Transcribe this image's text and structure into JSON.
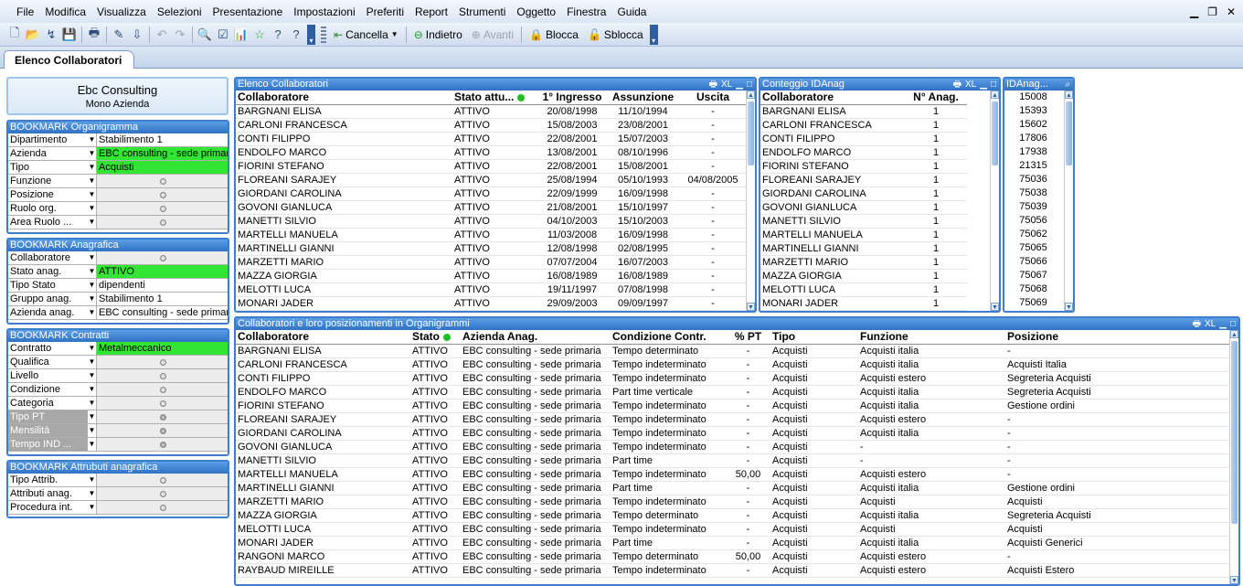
{
  "menu": {
    "items": [
      "File",
      "Modifica",
      "Visualizza",
      "Selezioni",
      "Presentazione",
      "Impostazioni",
      "Preferiti",
      "Report",
      "Strumenti",
      "Oggetto",
      "Finestra",
      "Guida"
    ]
  },
  "toolbar": {
    "cancella": "Cancella",
    "indietro": "Indietro",
    "avanti": "Avanti",
    "blocca": "Blocca",
    "sblocca": "Sblocca"
  },
  "tab": {
    "label": "Elenco Collaboratori"
  },
  "logo": {
    "title": "Ebc Consulting",
    "subtitle": "Mono Azienda"
  },
  "bm_org": {
    "title": "BOOKMARK Organigramma",
    "rows": [
      {
        "label": "Dipartimento",
        "value": "Stabilimento 1",
        "state": "val"
      },
      {
        "label": "Azienda",
        "value": "EBC consulting - sede primaria",
        "state": "sel"
      },
      {
        "label": "Tipo",
        "value": "Acquisti",
        "state": "sel"
      },
      {
        "label": "Funzione",
        "value": "",
        "state": "empty"
      },
      {
        "label": "Posizione",
        "value": "",
        "state": "empty"
      },
      {
        "label": "Ruolo org.",
        "value": "",
        "state": "empty"
      },
      {
        "label": "Area Ruolo ...",
        "value": "",
        "state": "empty"
      }
    ]
  },
  "bm_anag": {
    "title": "BOOKMARK Anagrafica",
    "rows": [
      {
        "label": "Collaboratore",
        "value": "",
        "state": "empty"
      },
      {
        "label": "Stato anag.",
        "value": "ATTIVO",
        "state": "sel"
      },
      {
        "label": "Tipo Stato",
        "value": "dipendenti",
        "state": "val"
      },
      {
        "label": "Gruppo anag.",
        "value": "Stabilimento 1",
        "state": "val"
      },
      {
        "label": "Azienda anag.",
        "value": "EBC consulting - sede primaria",
        "state": "val"
      }
    ]
  },
  "bm_contr": {
    "title": "BOOKMARK Contratti",
    "rows": [
      {
        "label": "Contratto",
        "value": "Metalmeccanico",
        "state": "sel"
      },
      {
        "label": "Qualifica",
        "value": "",
        "state": "empty"
      },
      {
        "label": "Livello",
        "value": "",
        "state": "empty"
      },
      {
        "label": "Condizione",
        "value": "",
        "state": "empty"
      },
      {
        "label": "Categoria",
        "value": "",
        "state": "empty"
      },
      {
        "label": "Tipo PT",
        "value": "",
        "state": "grey"
      },
      {
        "label": "Mensilità",
        "value": "",
        "state": "grey"
      },
      {
        "label": "Tempo IND ...",
        "value": "",
        "state": "grey"
      }
    ]
  },
  "bm_attr": {
    "title": "BOOKMARK Attrubuti anagrafica",
    "rows": [
      {
        "label": "Tipo Attrib.",
        "value": "",
        "state": "empty"
      },
      {
        "label": "Attributi anag.",
        "value": "",
        "state": "empty"
      },
      {
        "label": "Procedura int.",
        "value": "",
        "state": "empty"
      }
    ]
  },
  "elenco": {
    "title": "Elenco Collaboratori",
    "cols": [
      "Collaboratore",
      "Stato attu...",
      "1° Ingresso",
      "Assunzione",
      "Uscita"
    ],
    "rows": [
      [
        "BARGNANI ELISA",
        "ATTIVO",
        "20/08/1998",
        "11/10/1994",
        "-"
      ],
      [
        "CARLONI FRANCESCA",
        "ATTIVO",
        "15/08/2003",
        "23/08/2001",
        "-"
      ],
      [
        "CONTI FILIPPO",
        "ATTIVO",
        "22/08/2001",
        "15/07/2003",
        "-"
      ],
      [
        "ENDOLFO MARCO",
        "ATTIVO",
        "13/08/2001",
        "08/10/1996",
        "-"
      ],
      [
        "FIORINI STEFANO",
        "ATTIVO",
        "22/08/2001",
        "15/08/2001",
        "-"
      ],
      [
        "FLOREANI SARAJEY",
        "ATTIVO",
        "25/08/1994",
        "05/10/1993",
        "04/08/2005"
      ],
      [
        "GIORDANI CAROLINA",
        "ATTIVO",
        "22/09/1999",
        "16/09/1998",
        "-"
      ],
      [
        "GOVONI GIANLUCA",
        "ATTIVO",
        "21/08/2001",
        "15/10/1997",
        "-"
      ],
      [
        "MANETTI SILVIO",
        "ATTIVO",
        "04/10/2003",
        "15/10/2003",
        "-"
      ],
      [
        "MARTELLI MANUELA",
        "ATTIVO",
        "11/03/2008",
        "16/09/1998",
        "-"
      ],
      [
        "MARTINELLI GIANNI",
        "ATTIVO",
        "12/08/1998",
        "02/08/1995",
        "-"
      ],
      [
        "MARZETTI MARIO",
        "ATTIVO",
        "07/07/2004",
        "16/07/2003",
        "-"
      ],
      [
        "MAZZA GIORGIA",
        "ATTIVO",
        "16/08/1989",
        "16/08/1989",
        "-"
      ],
      [
        "MELOTTI LUCA",
        "ATTIVO",
        "19/11/1997",
        "07/08/1998",
        "-"
      ],
      [
        "MONARI JADER",
        "ATTIVO",
        "29/09/2003",
        "09/09/1997",
        "-"
      ]
    ]
  },
  "conteggio": {
    "title": "Conteggio IDAnag",
    "cols": [
      "Collaboratore",
      "N° Anag."
    ],
    "rows": [
      [
        "BARGNANI ELISA",
        "1"
      ],
      [
        "CARLONI FRANCESCA",
        "1"
      ],
      [
        "CONTI FILIPPO",
        "1"
      ],
      [
        "ENDOLFO MARCO",
        "1"
      ],
      [
        "FIORINI STEFANO",
        "1"
      ],
      [
        "FLOREANI SARAJEY",
        "1"
      ],
      [
        "GIORDANI CAROLINA",
        "1"
      ],
      [
        "GOVONI GIANLUCA",
        "1"
      ],
      [
        "MANETTI SILVIO",
        "1"
      ],
      [
        "MARTELLI MANUELA",
        "1"
      ],
      [
        "MARTINELLI GIANNI",
        "1"
      ],
      [
        "MARZETTI MARIO",
        "1"
      ],
      [
        "MAZZA GIORGIA",
        "1"
      ],
      [
        "MELOTTI LUCA",
        "1"
      ],
      [
        "MONARI JADER",
        "1"
      ]
    ]
  },
  "idanag": {
    "title": "IDAnag...",
    "rows": [
      "15008",
      "15393",
      "15602",
      "17806",
      "17938",
      "21315",
      "75036",
      "75038",
      "75039",
      "75056",
      "75062",
      "75065",
      "75066",
      "75067",
      "75068",
      "75069"
    ]
  },
  "pos": {
    "title": "Collaboratori e loro posizionamenti in Organigrammi",
    "cols": [
      "Collaboratore",
      "Stato",
      "Azienda Anag.",
      "Condizione Contr.",
      "% PT",
      "Tipo",
      "Funzione",
      "Posizione"
    ],
    "rows": [
      [
        "BARGNANI ELISA",
        "ATTIVO",
        "EBC consulting - sede primaria",
        "Tempo determinato",
        "-",
        "Acquisti",
        "Acquisti italia",
        "-"
      ],
      [
        "CARLONI FRANCESCA",
        "ATTIVO",
        "EBC consulting - sede primaria",
        "Tempo indeterminato",
        "-",
        "Acquisti",
        "Acquisti italia",
        "Acquisti Italia"
      ],
      [
        "CONTI FILIPPO",
        "ATTIVO",
        "EBC consulting - sede primaria",
        "Tempo indeterminato",
        "-",
        "Acquisti",
        "Acquisti estero",
        "Segreteria Acquisti"
      ],
      [
        "ENDOLFO MARCO",
        "ATTIVO",
        "EBC consulting - sede primaria",
        "Part time verticale",
        "-",
        "Acquisti",
        "Acquisti italia",
        "Segreteria Acquisti"
      ],
      [
        "FIORINI STEFANO",
        "ATTIVO",
        "EBC consulting - sede primaria",
        "Tempo indeterminato",
        "-",
        "Acquisti",
        "Acquisti italia",
        "Gestione ordini"
      ],
      [
        "FLOREANI SARAJEY",
        "ATTIVO",
        "EBC consulting - sede primaria",
        "Tempo indeterminato",
        "-",
        "Acquisti",
        "Acquisti estero",
        "-"
      ],
      [
        "GIORDANI CAROLINA",
        "ATTIVO",
        "EBC consulting - sede primaria",
        "Tempo indeterminato",
        "-",
        "Acquisti",
        "Acquisti italia",
        "-"
      ],
      [
        "GOVONI GIANLUCA",
        "ATTIVO",
        "EBC consulting - sede primaria",
        "Tempo indeterminato",
        "-",
        "Acquisti",
        "-",
        "-"
      ],
      [
        "MANETTI SILVIO",
        "ATTIVO",
        "EBC consulting - sede primaria",
        "Part time",
        "-",
        "Acquisti",
        "-",
        "-"
      ],
      [
        "MARTELLI MANUELA",
        "ATTIVO",
        "EBC consulting - sede primaria",
        "Tempo indeterminato",
        "50,00",
        "Acquisti",
        "Acquisti estero",
        "-"
      ],
      [
        "MARTINELLI GIANNI",
        "ATTIVO",
        "EBC consulting - sede primaria",
        "Part time",
        "-",
        "Acquisti",
        "Acquisti italia",
        "Gestione ordini"
      ],
      [
        "MARZETTI MARIO",
        "ATTIVO",
        "EBC consulting - sede primaria",
        "Tempo indeterminato",
        "-",
        "Acquisti",
        "Acquisti",
        "Acquisti"
      ],
      [
        "MAZZA GIORGIA",
        "ATTIVO",
        "EBC consulting - sede primaria",
        "Tempo determinato",
        "-",
        "Acquisti",
        "Acquisti italia",
        "Segreteria Acquisti"
      ],
      [
        "MELOTTI LUCA",
        "ATTIVO",
        "EBC consulting - sede primaria",
        "Tempo indeterminato",
        "-",
        "Acquisti",
        "Acquisti",
        "Acquisti"
      ],
      [
        "MONARI JADER",
        "ATTIVO",
        "EBC consulting - sede primaria",
        "Part time",
        "-",
        "Acquisti",
        "Acquisti italia",
        "Acquisti Generici"
      ],
      [
        "RANGONI MARCO",
        "ATTIVO",
        "EBC consulting - sede primaria",
        "Tempo determinato",
        "50,00",
        "Acquisti",
        "Acquisti estero",
        "-"
      ],
      [
        "RAYBAUD MIREILLE",
        "ATTIVO",
        "EBC consulting - sede primaria",
        "Tempo indeterminato",
        "-",
        "Acquisti",
        "Acquisti estero",
        "Acquisti Estero"
      ]
    ]
  }
}
